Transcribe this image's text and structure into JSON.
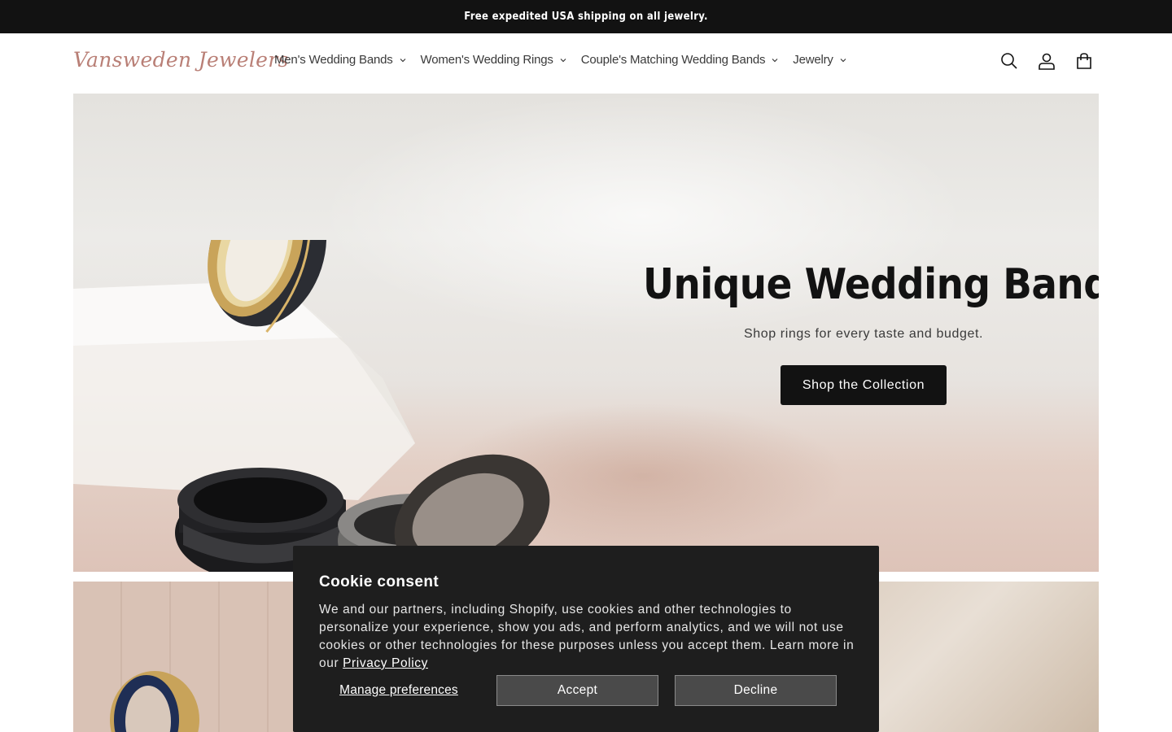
{
  "announcement": {
    "text": "Free expedited USA shipping on all jewelry."
  },
  "header": {
    "logo": "Vansweden Jewelers",
    "nav": [
      {
        "label": "Men's Wedding Bands"
      },
      {
        "label": "Women's Wedding Rings"
      },
      {
        "label": "Couple's Matching Wedding Bands"
      },
      {
        "label": "Jewelry"
      }
    ],
    "icons": [
      "search-icon",
      "account-icon",
      "cart-icon"
    ]
  },
  "hero": {
    "title": "Unique Wedding Bands",
    "subtitle": "Shop rings for every taste and budget.",
    "button": "Shop the Collection"
  },
  "cookie": {
    "title": "Cookie consent",
    "text": "We and our partners, including Shopify, use cookies and other technologies to personalize your experience, show you ads, and perform analytics, and we will not use cookies or other technologies for these purposes unless you accept them. Learn more in our ",
    "link": "Privacy Policy",
    "manage": "Manage preferences",
    "accept": "Accept",
    "decline": "Decline"
  },
  "colors": {
    "announcement_bg": "#121212",
    "logo": "#b97f76",
    "button_bg": "#121212",
    "cookie_bg": "#1e1e1e"
  }
}
